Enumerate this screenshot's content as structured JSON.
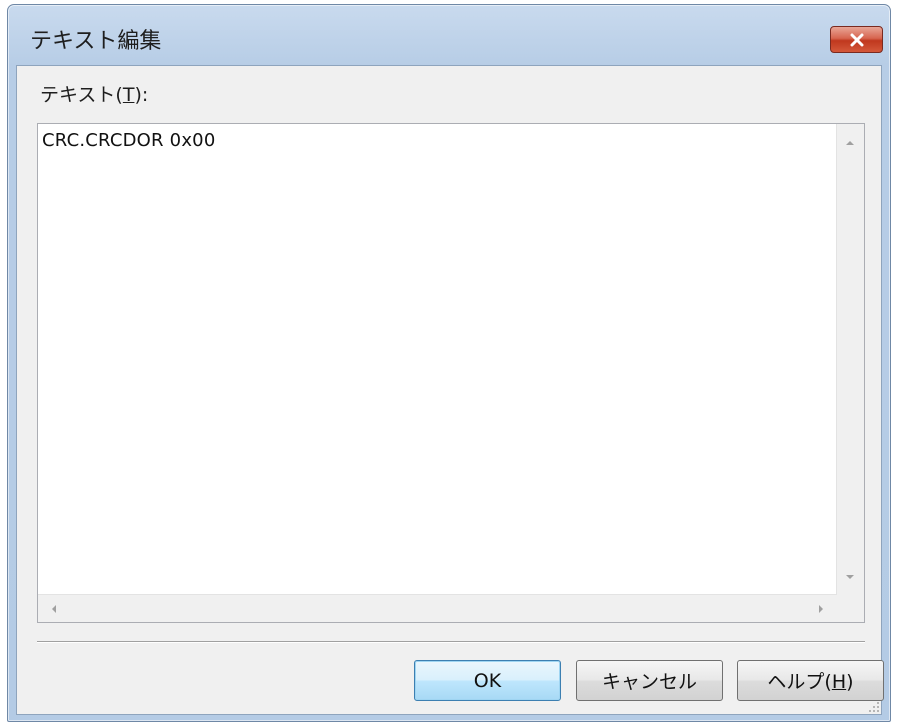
{
  "window": {
    "title": "テキスト編集"
  },
  "field": {
    "label_prefix": "テキスト(",
    "label_mnemonic": "T",
    "label_suffix": "):",
    "value": "CRC.CRCDOR 0x00"
  },
  "buttons": {
    "ok": "OK",
    "cancel": "キャンセル",
    "help_prefix": "ヘルプ(",
    "help_mnemonic": "H",
    "help_suffix": ")"
  },
  "icons": {
    "close": "close-icon",
    "scroll_up": "scroll-up-arrow-icon",
    "scroll_down": "scroll-down-arrow-icon",
    "scroll_left": "scroll-left-arrow-icon",
    "scroll_right": "scroll-right-arrow-icon",
    "resize_grip": "resize-grip-icon"
  },
  "colors": {
    "title_gradient_top": "#c9daee",
    "close_button": "#c0381e",
    "ok_button_border": "#3c7fb1",
    "client_background": "#f0f0f0"
  }
}
